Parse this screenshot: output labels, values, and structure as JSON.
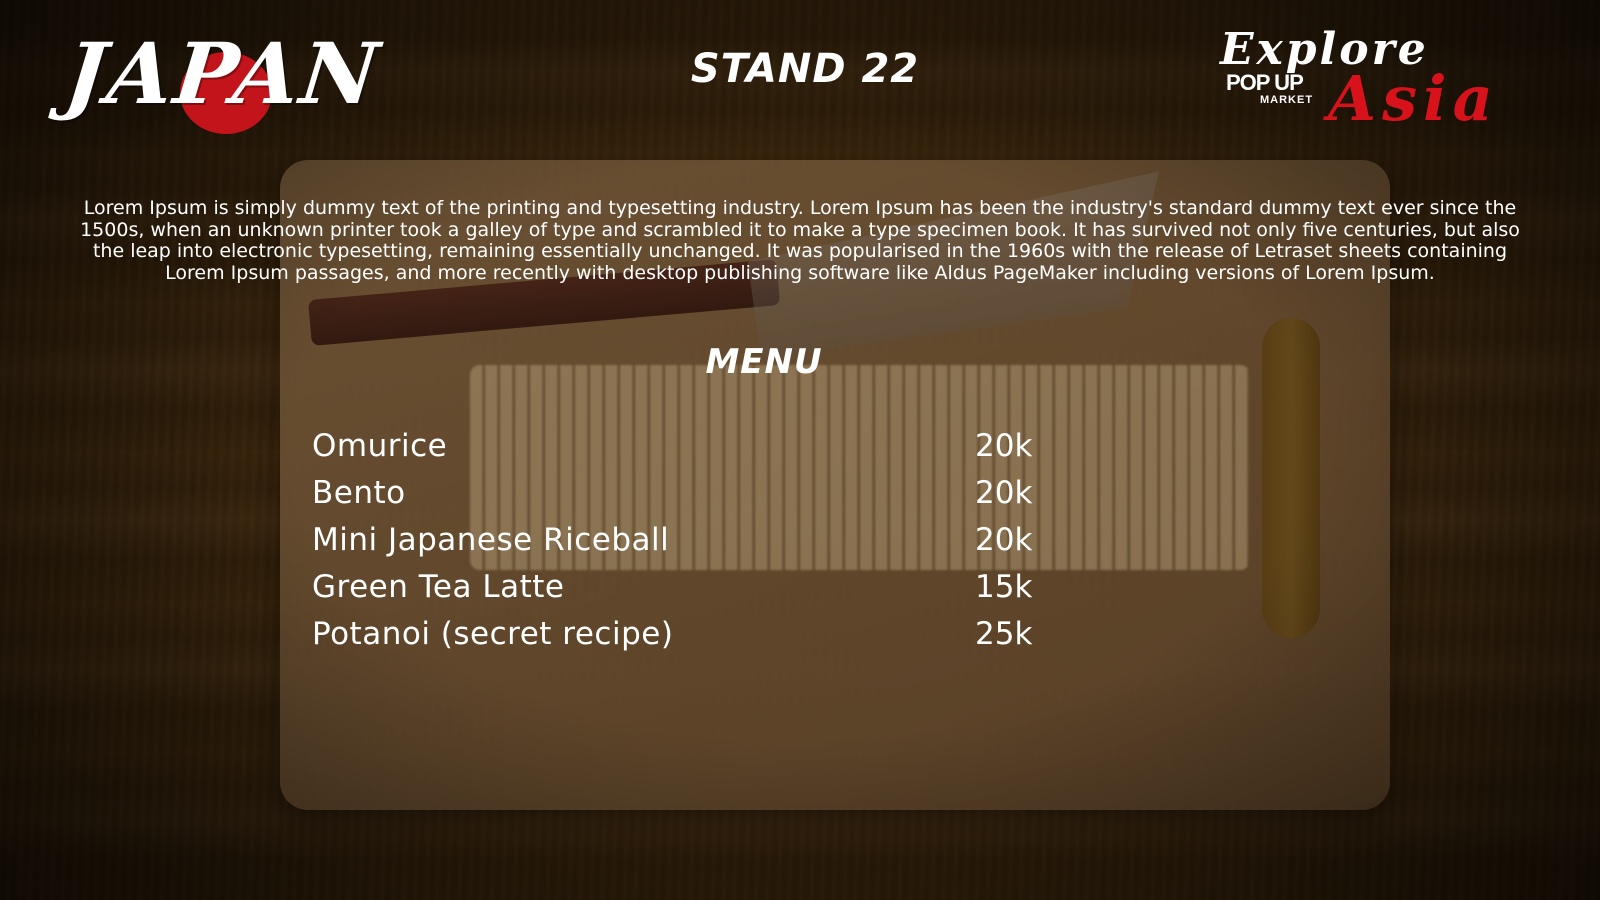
{
  "header": {
    "logo_text": "JAPAN",
    "stand_label": "STAND 22",
    "brand": {
      "line1": "Explore",
      "popup": "POP UP",
      "market": "MARKET",
      "asia": "Asia"
    }
  },
  "description": "Lorem Ipsum is simply dummy text of the printing and typesetting industry. Lorem Ipsum has been the industry's standard dummy text ever since the 1500s, when an unknown printer took a galley of type and scrambled it to make a type specimen book. It has survived not only five centuries, but also the leap into electronic typesetting, remaining essentially unchanged. It was popularised in the 1960s with the release of Letraset sheets containing Lorem Ipsum passages, and more recently with desktop publishing software like Aldus PageMaker including versions of Lorem Ipsum.",
  "menu": {
    "title": "MENU",
    "items": [
      {
        "name": "Omurice",
        "price": "20k"
      },
      {
        "name": "Bento",
        "price": "20k"
      },
      {
        "name": "Mini Japanese Riceball",
        "price": "20k"
      },
      {
        "name": "Green Tea Latte",
        "price": "15k"
      },
      {
        "name": "Potanoi (secret recipe)",
        "price": "25k"
      }
    ]
  },
  "colors": {
    "accent_red": "#d7121b",
    "text": "#ffffff",
    "wood": "#4f3311"
  }
}
